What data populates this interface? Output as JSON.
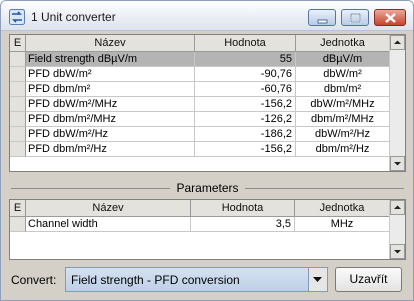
{
  "window": {
    "title": "1 Unit converter",
    "icon": "unit-converter-icon",
    "controls": [
      "minimize-icon",
      "maximize-icon",
      "close-icon"
    ]
  },
  "results_table": {
    "columns": [
      "E",
      "Název",
      "Hodnota",
      "Jednotka"
    ],
    "rows": [
      {
        "name": "Field strength dBµV/m",
        "value": "55",
        "unit": "dBµV/m",
        "selected": true
      },
      {
        "name": "PFD dbW/m²",
        "value": "-90,76",
        "unit": "dbW/m²",
        "selected": false
      },
      {
        "name": "PFD dbm/m²",
        "value": "-60,76",
        "unit": "dbm/m²",
        "selected": false
      },
      {
        "name": "PFD dbW/m²/MHz",
        "value": "-156,2",
        "unit": "dbW/m²/MHz",
        "selected": false
      },
      {
        "name": "PFD dbm/m²/MHz",
        "value": "-126,2",
        "unit": "dbm/m²/MHz",
        "selected": false
      },
      {
        "name": "PFD dbW/m²/Hz",
        "value": "-186,2",
        "unit": "dbW/m²/Hz",
        "selected": false
      },
      {
        "name": "PFD dbm/m²/Hz",
        "value": "-156,2",
        "unit": "dbm/m²/Hz",
        "selected": false
      }
    ]
  },
  "parameters": {
    "title": "Parameters",
    "columns": [
      "E",
      "Název",
      "Hodnota",
      "Jednotka"
    ],
    "rows": [
      {
        "name": "Channel width",
        "value": "3,5",
        "unit": "MHz"
      }
    ]
  },
  "footer": {
    "convert_label": "Convert:",
    "convert_selected": "Field strength - PFD conversion",
    "close_button": "Uzavřít"
  }
}
